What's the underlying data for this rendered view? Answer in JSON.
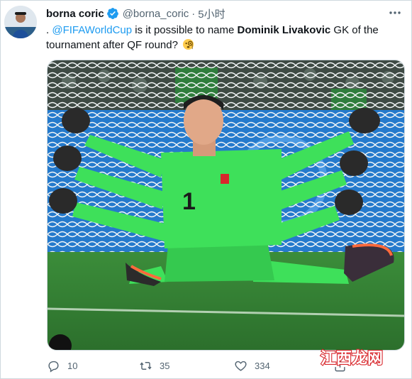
{
  "tweet": {
    "author_name": "borna coric",
    "handle": "@borna_coric",
    "separator": "·",
    "time": "5小时",
    "text": {
      "lead": ". ",
      "mention": "@FIFAWorldCup",
      "part1": " is it possible to name ",
      "bold": "Dominik Livakovic",
      "part2": " GK of the tournament after QF round? "
    },
    "media_alt": "Goalkeeper in green kit with number 1 sitting on the pitch with multiple arms spread wide in front of the goal net"
  },
  "actions": {
    "reply_count": "10",
    "retweet_count": "35",
    "like_count": "334"
  },
  "watermark": {
    "text": "江西龙网"
  },
  "icons": {
    "verified": "verified-badge-icon",
    "more": "more-dots-icon",
    "emoji": "monocle-face-emoji-icon",
    "reply": "reply-icon",
    "retweet": "retweet-icon",
    "like": "heart-icon",
    "share": "share-icon"
  },
  "colors": {
    "accent": "#1d9bf0",
    "text": "#0f1419",
    "muted": "#536471",
    "kit_green": "#3ee05a",
    "watermark_red": "#d8272c"
  }
}
